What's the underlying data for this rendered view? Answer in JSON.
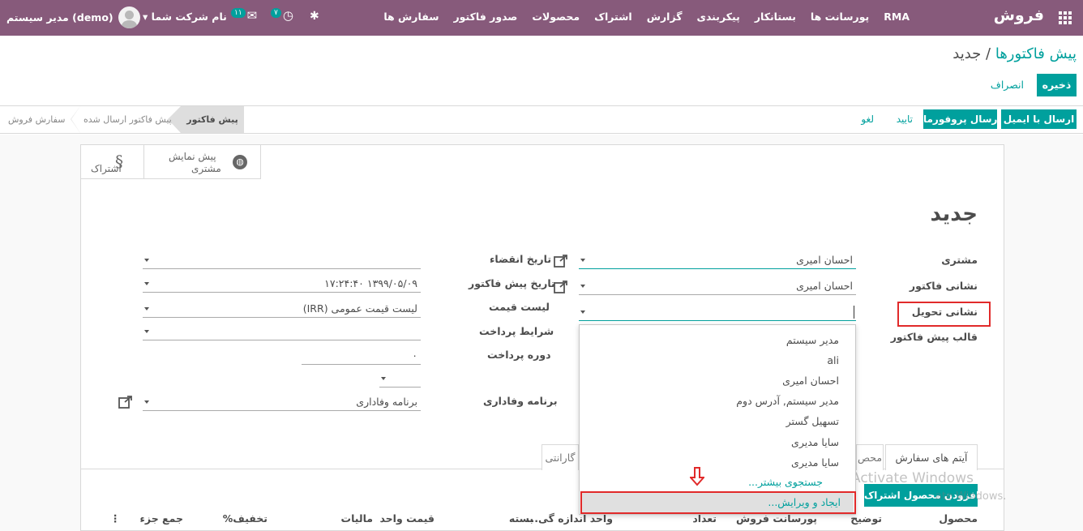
{
  "topbar": {
    "brand": "فروش",
    "menu": [
      "سفارش ها",
      "صدور فاکتور",
      "محصولات",
      "اشتراک",
      "گزارش",
      "پیکربندی",
      "بستانکار",
      "پورسانت ها",
      "RMA"
    ],
    "clock_count": "۷",
    "chat_count": "۱۱",
    "company": "نام شرکت شما",
    "user": "مدیر سیستم (demo)"
  },
  "breadcrumb": {
    "parent": "پیش فاکتورها",
    "separator": " / ",
    "current": "جدید"
  },
  "buttons": {
    "save": "ذخیره",
    "discard": "انصراف"
  },
  "statusbar": {
    "send_email": "ارسال با ایمیل",
    "send_proforma": "ارسال پروفورما",
    "confirm": "تایید",
    "cancel": "لغو",
    "stages": {
      "quotation": "پیش فاکتور",
      "sent": "پیش فاکتور ارسال شده",
      "order": "سفارش فروش"
    }
  },
  "button_box": {
    "subscriptions": "اشتراک",
    "preview_line1": "پیش نمایش",
    "preview_line2": "مشتری"
  },
  "form": {
    "title": "جدید",
    "left_labels": {
      "customer": "مشتری",
      "invoice_address": "نشانی فاکتور",
      "delivery_address": "نشانی تحویل",
      "template": "قالب پیش فاکتور"
    },
    "right_labels": {
      "expiration": "تاریخ انقضاء",
      "quotation_date": "تاریخ پیش فاکتور",
      "pricelist": "لیست قیمت",
      "payment_terms": "شرایط پرداخت",
      "payment_period": "دوره پرداخت",
      "loyalty": "برنامه وفاداری"
    },
    "values": {
      "customer": "احسان امیری",
      "invoice_address": "احسان امیری",
      "quotation_date": "۱۳۹۹/۰۵/۰۹ ۱۷:۲۴:۴۰",
      "pricelist": "لیست قیمت عمومی (IRR)",
      "payment_period": "۰",
      "loyalty": "برنامه وفاداری"
    }
  },
  "dropdown": {
    "items": [
      "مدیر سیستم",
      "ali",
      "احسان امیری",
      "مدیر سیستم, آدرس دوم",
      "تسهیل گستر",
      "سایا مدیری",
      "سایا مدیری"
    ],
    "search_more": "جستجوی بیشتر...",
    "create_edit": "ایجاد و ویرایش..."
  },
  "tabs": {
    "order_items": "آیتم های سفارش",
    "other": "محص",
    "guarantee": "گارانتی"
  },
  "add_subscription": "افزودن محصول اشتراک",
  "table_headers": {
    "product": "محصول",
    "description": "توضیح",
    "commission": "پورسانت فروش",
    "quantity": "تعداد",
    "uom": "واحد اندازه گی...",
    "package": "بسته",
    "unit_price": "قیمت واحد",
    "taxes": "مالیات",
    "discount": "تخفیف%",
    "subtotal": "جمع جزء"
  },
  "watermark": {
    "line1": "Activate Windows",
    "line2": "ate Windows."
  },
  "colors": {
    "nav": "#875a7b",
    "accent": "#00a09d",
    "highlight": "#e12a2a"
  },
  "icons": [
    "apps-grid-icon",
    "bug-icon",
    "clock-icon",
    "chat-icon",
    "avatar",
    "globe-icon",
    "subscription-icon",
    "external-link-icon",
    "down-arrow-icon"
  ]
}
